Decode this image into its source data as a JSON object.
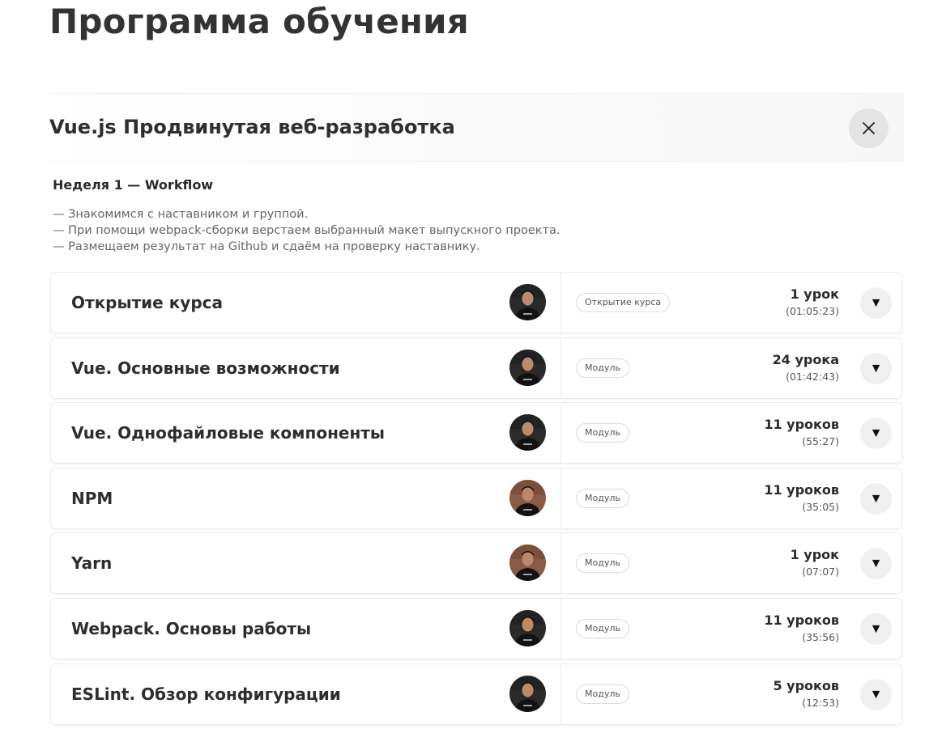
{
  "page": {
    "title": "Программа обучения"
  },
  "course": {
    "title": "Vue.js Продвинутая веб-разработка"
  },
  "week": {
    "title": "Неделя 1 — Workflow",
    "description": [
      "— Знакомимся с наставником и группой.",
      "— При помощи webpack-сборки верстаем выбранный макет выпускного проекта.",
      "— Размещаем результат на Github и сдаём на проверку наставнику."
    ]
  },
  "icons": {
    "close": "close-icon",
    "expand": "triangle-down-icon",
    "expand_glyph": "▼"
  },
  "modules": [
    {
      "title": "Открытие курса",
      "tag": "Открытие курса",
      "lessons": "1 урок",
      "duration": "(01:05:23)",
      "avatar": "mentor-dark"
    },
    {
      "title": "Vue. Основные возможности",
      "tag": "Модуль",
      "lessons": "24 урока",
      "duration": "(01:42:43)",
      "avatar": "mentor-dark"
    },
    {
      "title": "Vue. Однофайловые компоненты",
      "tag": "Модуль",
      "lessons": "11 уроков",
      "duration": "(55:27)",
      "avatar": "mentor-dark"
    },
    {
      "title": "NPM",
      "tag": "Модуль",
      "lessons": "11 уроков",
      "duration": "(35:05)",
      "avatar": "mentor-brick"
    },
    {
      "title": "Yarn",
      "tag": "Модуль",
      "lessons": "1 урок",
      "duration": "(07:07)",
      "avatar": "mentor-brick"
    },
    {
      "title": "Webpack. Основы работы",
      "tag": "Модуль",
      "lessons": "11 уроков",
      "duration": "(35:56)",
      "avatar": "mentor-dark"
    },
    {
      "title": "ESLint. Обзор конфигурации",
      "tag": "Модуль",
      "lessons": "5 уроков",
      "duration": "(12:53)",
      "avatar": "mentor-dark"
    }
  ],
  "colors": {
    "close_bg": "#e4e4e4",
    "expand_bg": "#f0f0f0",
    "title": "#333333"
  }
}
